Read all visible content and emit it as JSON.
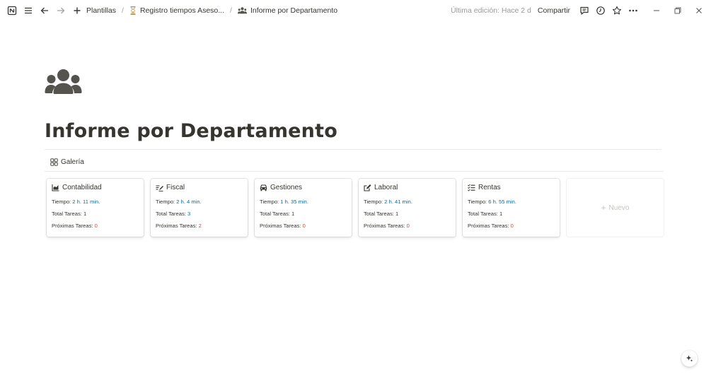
{
  "topbar": {
    "crumbs": [
      {
        "label": "Plantillas"
      },
      {
        "label": "Registro tiempos Aseso..."
      },
      {
        "label": "Informe por Departamento"
      }
    ],
    "last_edited": "Última edición: Hace 2 d",
    "share_label": "Compartir"
  },
  "page": {
    "icon": "people-group-icon",
    "title": "Informe por Departamento"
  },
  "view": {
    "tab_label": "Galería",
    "new_label": "Nuevo"
  },
  "labels": {
    "tiempo": "Tiempo: ",
    "total": "Total Tareas: ",
    "proximas": "Próximas Tareas: "
  },
  "cards": [
    {
      "name": "Contabilidad",
      "icon": "chart-icon",
      "tiempo": "2 h. 11 min.",
      "total": "1",
      "proximas": "0"
    },
    {
      "name": "Fiscal",
      "icon": "signature-icon",
      "tiempo": "2 h. 4 min.",
      "total": "3",
      "proximas": "2"
    },
    {
      "name": "Gestiones",
      "icon": "car-icon",
      "tiempo": "1 h. 35 min.",
      "total": "1",
      "proximas": "0"
    },
    {
      "name": "Laboral",
      "icon": "edit-icon",
      "tiempo": "2 h. 41 min.",
      "total": "1",
      "proximas": "0"
    },
    {
      "name": "Rentas",
      "icon": "tasks-icon",
      "tiempo": "6 h. 55 min.",
      "total": "1",
      "proximas": "0"
    }
  ],
  "colors": {
    "text": "#37352f",
    "link_value": "#0b6e99",
    "red_value": "#e03e3e",
    "muted": "#9b9a97"
  }
}
